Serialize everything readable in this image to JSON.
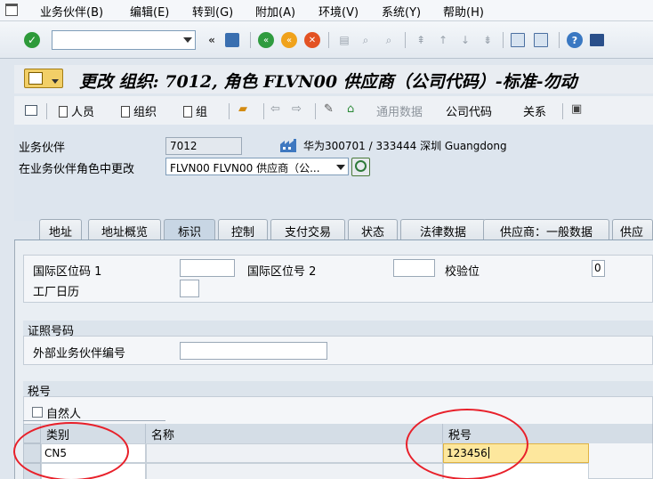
{
  "menu": {
    "items": [
      "业务伙伴(B)",
      "编辑(E)",
      "转到(G)",
      "附加(A)",
      "环境(V)",
      "系统(Y)",
      "帮助(H)"
    ]
  },
  "toolbar": {
    "command_value": "",
    "icons": [
      "check-icon",
      "save-icon",
      "back-icon",
      "exit-icon",
      "cancel-icon",
      "print-icon",
      "find-icon",
      "find-next-icon",
      "first-page-icon",
      "prev-page-icon",
      "next-page-icon",
      "last-page-icon",
      "new-session-icon",
      "shortcut-icon",
      "help-icon",
      "customize-icon"
    ]
  },
  "title": "更改 组织: 7012, 角色 FLVN00 供应商（公司代码）-标准-勿动",
  "app_toolbar": {
    "person": "人员",
    "org": "组织",
    "group": "组",
    "general_data": "通用数据",
    "company_code": "公司代码",
    "relations": "关系"
  },
  "header": {
    "bp_label": "业务伙伴",
    "bp_value": "7012",
    "bp_desc": "华为300701 / 333444 深圳 Guangdong",
    "role_label": "在业务伙伴角色中更改",
    "role_value": "FLVN00 FLVN00 供应商（公..."
  },
  "tabs": [
    "地址",
    "地址概览",
    "标识",
    "控制",
    "支付交易",
    "状态",
    "法律数据",
    "供应商：一般数据",
    "供应"
  ],
  "identification": {
    "intl_loc_1": "国际区位码 1",
    "intl_loc_2": "国际区位号 2",
    "check_digit": "校验位",
    "check_digit_value": "0",
    "factory_calendar": "工厂日历"
  },
  "id_numbers": {
    "header": "证照号码",
    "ext_bp_no": "外部业务伙伴编号"
  },
  "tax": {
    "header": "税号",
    "natural_person": "自然人",
    "columns": [
      "类别",
      "名称",
      "税号"
    ],
    "rows": [
      {
        "category": "CN5",
        "name": "",
        "tax_number": "123456"
      }
    ]
  },
  "colors": {
    "annotation": "#e8202a",
    "active_cell": "#fde79d"
  }
}
